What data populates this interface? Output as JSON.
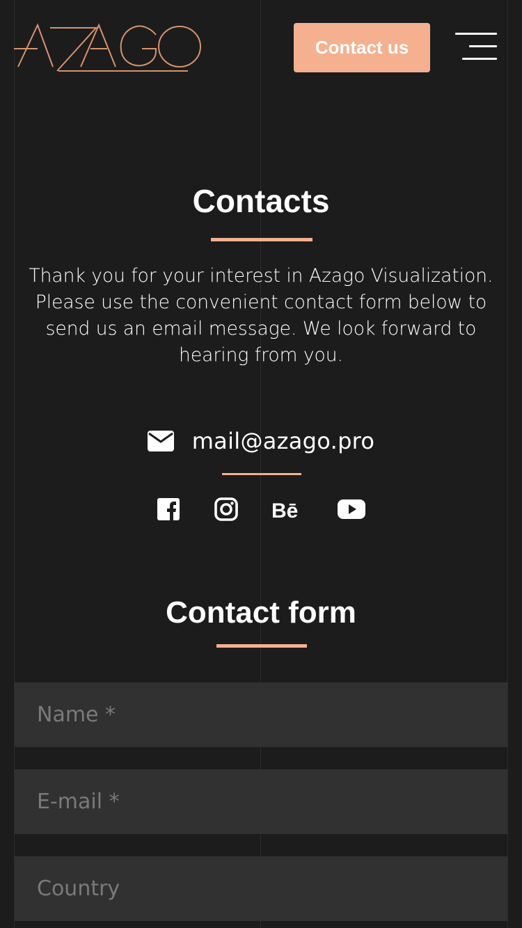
{
  "header": {
    "logo_text": "AZAGO",
    "contact_button_label": "Contact us"
  },
  "contacts": {
    "title": "Contacts",
    "intro": "Thank you for your interest in Azago Visualization. Please use the convenient contact form below to send us an email message. We look forward to hearing from you.",
    "email": "mail@azago.pro",
    "social_icons": [
      "facebook-icon",
      "instagram-icon",
      "behance-icon",
      "youtube-icon"
    ]
  },
  "contact_form": {
    "title": "Contact form",
    "fields": {
      "name_placeholder": "Name *",
      "email_placeholder": "E-mail *",
      "country_placeholder": "Country"
    }
  },
  "colors": {
    "accent": "#f5b08f",
    "background": "#1c1c1c",
    "field_background": "#313131"
  }
}
